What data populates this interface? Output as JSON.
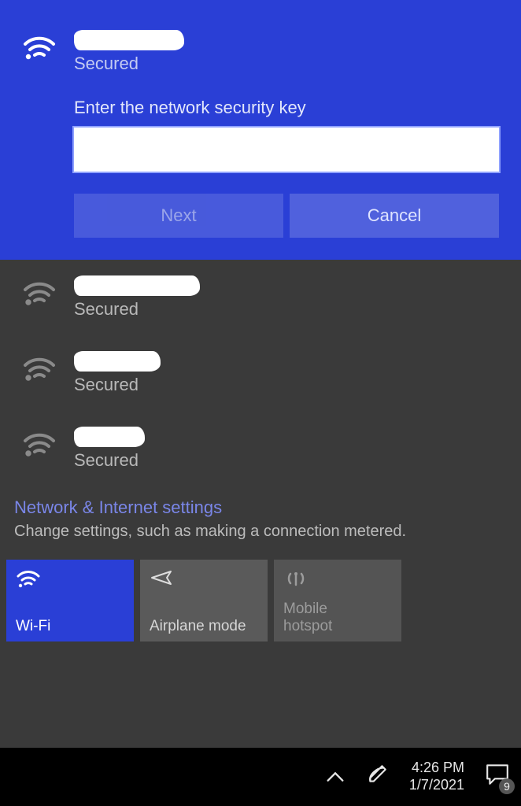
{
  "selected": {
    "name_redacted": true,
    "status": "Secured",
    "prompt": "Enter the network security key",
    "input_value": "",
    "next_label": "Next",
    "cancel_label": "Cancel"
  },
  "networks": [
    {
      "name_redacted": true,
      "status": "Secured"
    },
    {
      "name_redacted": true,
      "status": "Secured"
    },
    {
      "name_redacted": true,
      "status": "Secured"
    }
  ],
  "settings": {
    "link": "Network & Internet settings",
    "desc": "Change settings, such as making a connection metered."
  },
  "tiles": {
    "wifi": "Wi-Fi",
    "airplane": "Airplane mode",
    "hotspot_top": "Mobile",
    "hotspot_bottom": "hotspot"
  },
  "taskbar": {
    "time": "4:26 PM",
    "date": "1/7/2021",
    "badge": "9"
  }
}
